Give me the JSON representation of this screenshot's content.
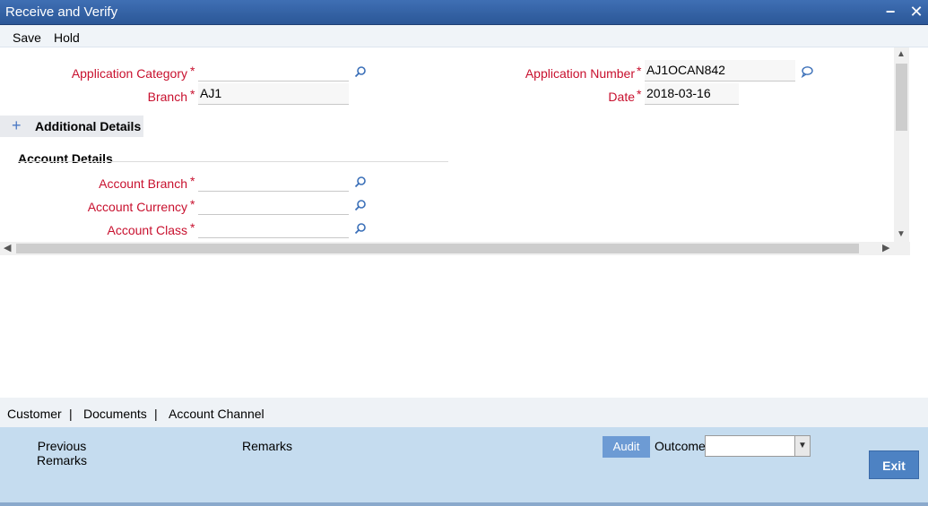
{
  "window": {
    "title": "Receive and Verify",
    "minimize_glyph": "−",
    "close_glyph": "✕"
  },
  "menu": {
    "save": "Save",
    "hold": "Hold"
  },
  "form": {
    "application_category": {
      "label": "Application Category",
      "required": "*",
      "value": ""
    },
    "branch": {
      "label": "Branch",
      "required": "*",
      "value": "AJ1"
    },
    "application_number": {
      "label": "Application Number",
      "required": "*",
      "value": "AJ1OCAN842"
    },
    "date": {
      "label": "Date",
      "required": "*",
      "value": "2018-03-16"
    }
  },
  "additional_details": {
    "toggle": "+",
    "label": "Additional Details"
  },
  "account_details": {
    "heading": "Account Details",
    "account_branch": {
      "label": "Account Branch",
      "required": "*",
      "value": ""
    },
    "account_currency": {
      "label": "Account Currency",
      "required": "*",
      "value": ""
    },
    "account_class": {
      "label": "Account Class",
      "required": "*",
      "value": ""
    }
  },
  "tabs": {
    "customer": "Customer",
    "documents": "Documents",
    "account_channel": "Account Channel",
    "separator": "|"
  },
  "footer": {
    "previous_remarks_line1": "Previous",
    "previous_remarks_line2": "Remarks",
    "remarks": "Remarks",
    "audit": "Audit",
    "outcome_label": "Outcome",
    "outcome_value": "",
    "exit": "Exit"
  },
  "icons": {
    "search": "magnifier-icon",
    "comment": "speech-bubble-icon"
  },
  "colors": {
    "title_bar": "#2b5797",
    "required_label": "#c8102e",
    "footer_bg": "#c5dcef",
    "exit_button": "#4d82c3"
  }
}
